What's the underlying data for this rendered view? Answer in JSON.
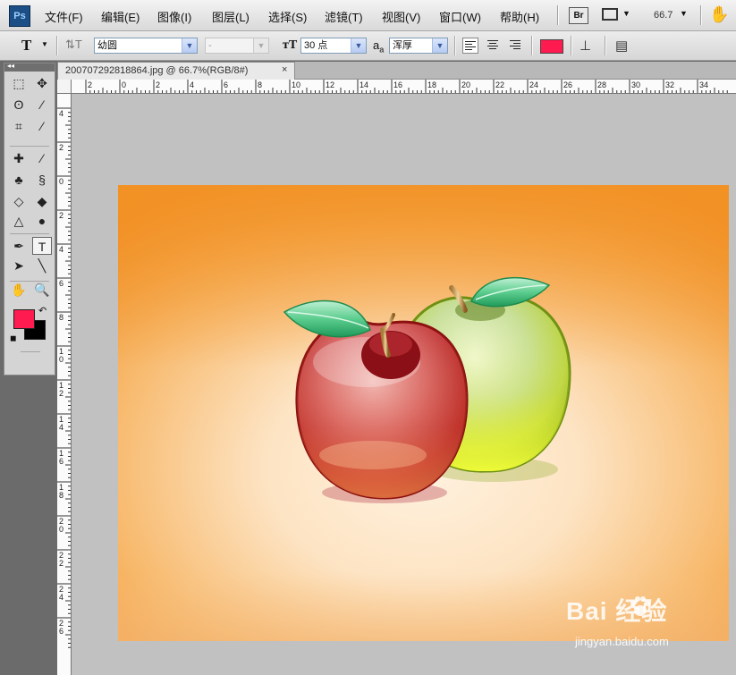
{
  "app": {
    "logo": "Ps"
  },
  "menu": {
    "items": [
      "文件(F)",
      "编辑(E)",
      "图像(I)",
      "图层(L)",
      "选择(S)",
      "滤镜(T)",
      "视图(V)",
      "窗口(W)",
      "帮助(H)"
    ],
    "bridge_label": "Br",
    "zoom_value": "66.7",
    "icons": [
      "screen-mode-icon",
      "hand-icon"
    ]
  },
  "options": {
    "tool_glyph": "T",
    "font_family": "幼圆",
    "font_style": "-",
    "font_size": "30 点",
    "antialias_glyph": "a",
    "antialias_sub": "a",
    "antialias": "浑厚",
    "text_color": "#ff1a4f",
    "alignment": [
      "left",
      "center",
      "right"
    ],
    "active_alignment": "left"
  },
  "document": {
    "tab_title": "200707292818864.jpg @ 66.7%(RGB/8#)",
    "close_glyph": "×"
  },
  "ruler": {
    "h_labels": [
      "2",
      "0",
      "2",
      "4",
      "6",
      "8",
      "10",
      "12",
      "14",
      "16",
      "18",
      "20",
      "22",
      "24",
      "26",
      "28",
      "30",
      "32",
      "34"
    ],
    "v_labels": [
      "4",
      "2",
      "0",
      "2",
      "4",
      "6",
      "8",
      "1 0",
      "1 2",
      "1 4",
      "1 6",
      "1 8",
      "2 0",
      "2 2",
      "2 4",
      "2 6"
    ]
  },
  "toolbox": {
    "collapse_glyph": "◂◂",
    "foreground_color": "#ff1a4f",
    "background_color": "#000000",
    "tools": [
      {
        "name": "marquee-tool-icon",
        "glyph": "⬚"
      },
      {
        "name": "move-tool-icon",
        "glyph": "✥"
      },
      {
        "name": "lasso-tool-icon",
        "glyph": "ʘ"
      },
      {
        "name": "magic-wand-tool-icon",
        "glyph": "⁄"
      },
      {
        "name": "crop-tool-icon",
        "glyph": "⌗"
      },
      {
        "name": "eyedropper-tool-icon",
        "glyph": "⁄"
      },
      {
        "name": "healing-brush-tool-icon",
        "glyph": "✚"
      },
      {
        "name": "brush-tool-icon",
        "glyph": "⁄"
      },
      {
        "name": "clone-stamp-tool-icon",
        "glyph": "♣"
      },
      {
        "name": "history-brush-tool-icon",
        "glyph": "§"
      },
      {
        "name": "eraser-tool-icon",
        "glyph": "◇"
      },
      {
        "name": "paint-bucket-tool-icon",
        "glyph": "◆"
      },
      {
        "name": "blur-tool-icon",
        "glyph": "△"
      },
      {
        "name": "dodge-tool-icon",
        "glyph": "●"
      },
      {
        "name": "pen-tool-icon",
        "glyph": "✒"
      },
      {
        "name": "type-tool-icon",
        "glyph": "T"
      },
      {
        "name": "path-selection-tool-icon",
        "glyph": "➤"
      },
      {
        "name": "line-tool-icon",
        "glyph": "╲"
      },
      {
        "name": "hand-tool-icon",
        "glyph": "✋"
      },
      {
        "name": "zoom-tool-icon",
        "glyph": "🔍"
      }
    ]
  },
  "watermark": {
    "brand": "Bai 经验",
    "url": "jingyan.baidu.com"
  }
}
